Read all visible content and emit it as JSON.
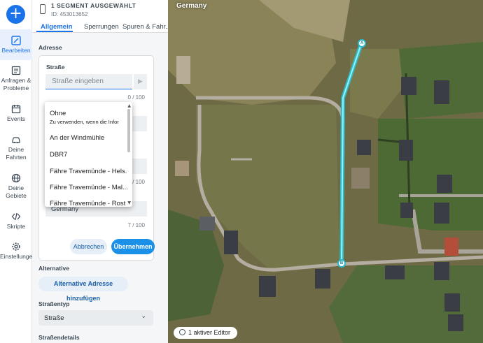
{
  "sidebar": {
    "add_label": "+",
    "items": [
      {
        "label": "Bearbeiten",
        "icon": "edit-map-icon"
      },
      {
        "label": "Anfragen & Probleme",
        "icon": "reports-icon"
      },
      {
        "label": "Events",
        "icon": "calendar-icon"
      },
      {
        "label": "Deine Fahrten",
        "icon": "car-icon"
      },
      {
        "label": "Deine Gebiete",
        "icon": "globe-icon"
      },
      {
        "label": "Skripte",
        "icon": "code-icon"
      },
      {
        "label": "Einstellungen",
        "icon": "gear-icon"
      }
    ]
  },
  "selection": {
    "title": "1 SEGMENT AUSGEWÄHLT",
    "id_text": "ID: 453013652"
  },
  "tabs": [
    "Allgemein",
    "Sperrungen",
    "Spuren & Fahr..."
  ],
  "address": {
    "section_label": "Adresse",
    "street_label": "Straße",
    "street_placeholder": "Straße eingeben",
    "street_counter": "0 / 100",
    "city_counter": "0 / 100",
    "country_value": "Germany",
    "country_counter": "7 / 100",
    "cancel_label": "Abbrechen",
    "apply_label": "Übernehmen"
  },
  "dropdown": {
    "options": [
      {
        "label": "Ohne",
        "sub": "Zu verwenden, wenn die Infor"
      },
      {
        "label": "An der Windmühle"
      },
      {
        "label": "DBR7"
      },
      {
        "label": "Fähre Travemünde - Hels."
      },
      {
        "label": "Fähre Travemünde - Mal..."
      },
      {
        "label": "Fähre Travemünde - Rost"
      }
    ]
  },
  "alternative": {
    "section_label": "Alternative",
    "button_label": "Alternative Adresse hinzufügen"
  },
  "road_type": {
    "section_label": "Straßentyp",
    "value": "Straße"
  },
  "street_details": {
    "section_label": "Straßendetails"
  },
  "map": {
    "title": "Germany",
    "editor_status": "1 aktiver Editor",
    "marker_a": "A",
    "marker_b": "B",
    "highlight_color": "#4fe3f0"
  }
}
